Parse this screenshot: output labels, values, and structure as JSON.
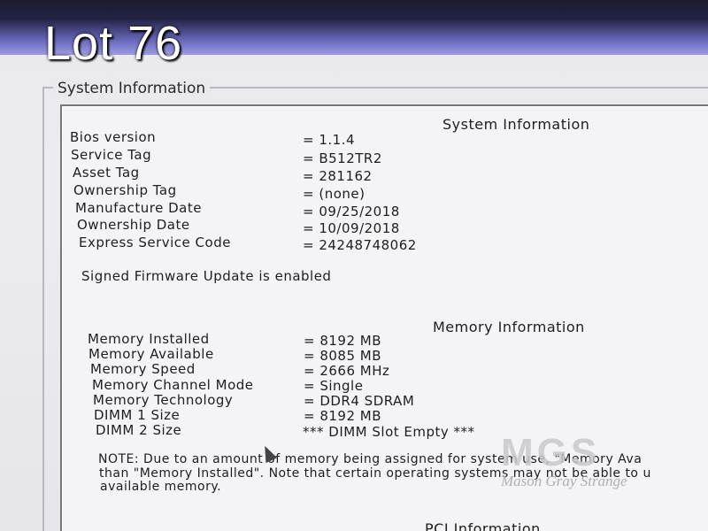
{
  "overlay": {
    "lot_label": "Lot 76"
  },
  "window": {
    "group_title": "System Information"
  },
  "system_info": {
    "header": "System Information",
    "rows": [
      {
        "label": "Bios version",
        "value": "= 1.1.4"
      },
      {
        "label": "Service Tag",
        "value": "= B512TR2"
      },
      {
        "label": "Asset Tag",
        "value": "= 281162"
      },
      {
        "label": "Ownership Tag",
        "value": "= (none)"
      },
      {
        "label": "Manufacture Date",
        "value": "= 09/25/2018"
      },
      {
        "label": "Ownership Date",
        "value": "= 10/09/2018"
      },
      {
        "label": "Express Service Code",
        "value": "= 24248748062"
      }
    ],
    "firmware_note": "Signed Firmware Update is enabled"
  },
  "memory_info": {
    "header": "Memory Information",
    "rows": [
      {
        "label": "Memory Installed",
        "value": "= 8192 MB"
      },
      {
        "label": "Memory Available",
        "value": "= 8085 MB"
      },
      {
        "label": "Memory Speed",
        "value": "= 2666 MHz"
      },
      {
        "label": "Memory Channel Mode",
        "value": "= Single"
      },
      {
        "label": "Memory Technology",
        "value": "= DDR4 SDRAM"
      },
      {
        "label": "DIMM 1 Size",
        "value": "= 8192 MB"
      },
      {
        "label": "DIMM 2 Size",
        "value": "*** DIMM Slot Empty ***"
      }
    ],
    "note_lines": [
      "NOTE: Due to an amount of memory being assigned for system use, \"Memory Ava",
      "than \"Memory Installed\". Note that certain operating systems may not be able to u",
      "available memory."
    ]
  },
  "pci_info": {
    "header": "PCI Information"
  },
  "watermark": {
    "logo": "MGS",
    "name": "Mason Gray Strange"
  }
}
